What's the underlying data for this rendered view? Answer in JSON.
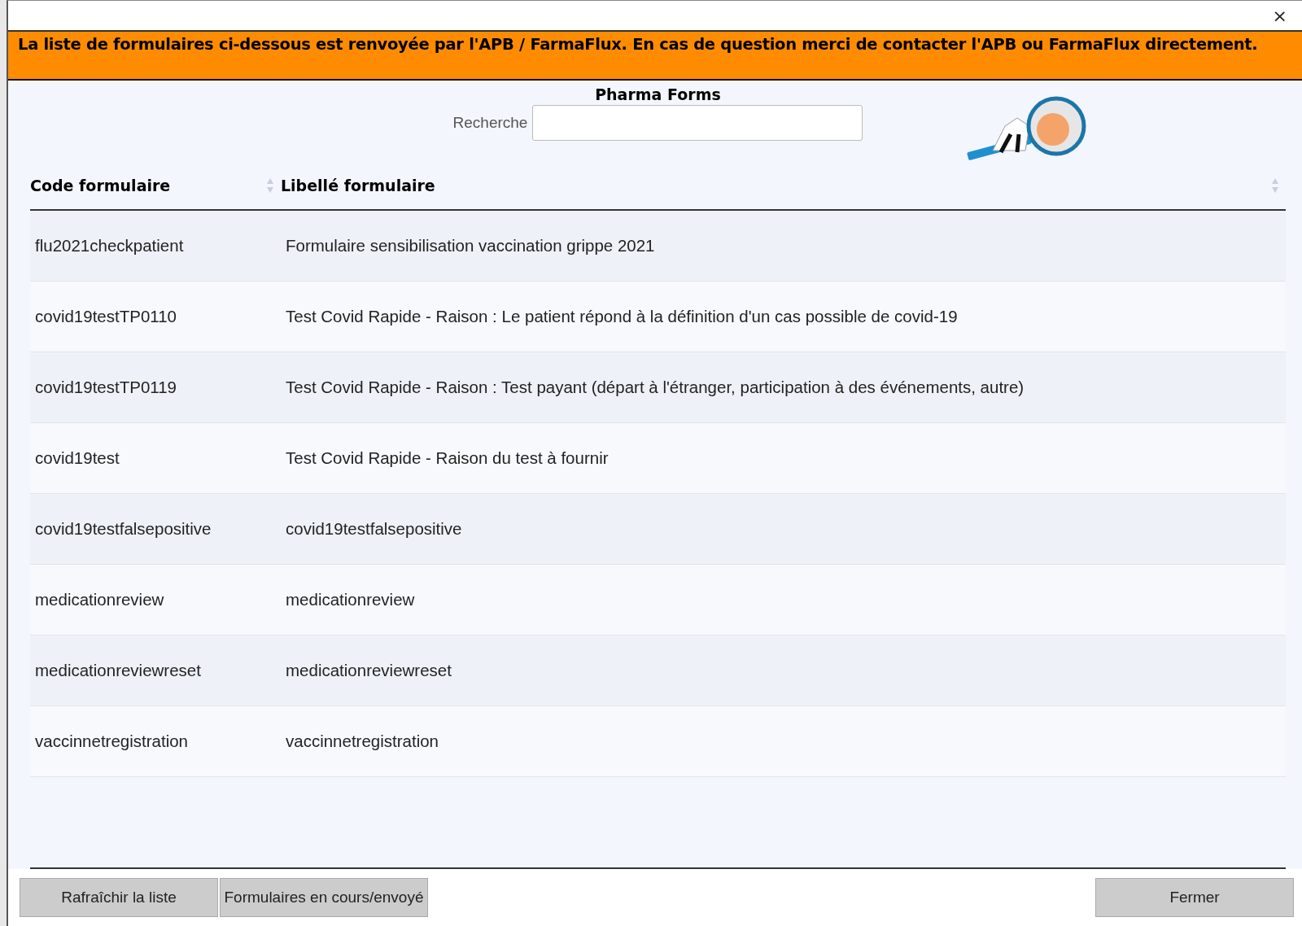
{
  "window": {
    "close": "×"
  },
  "banner": "La liste de formulaires ci-dessous est renvoyée par l'APB / FarmaFlux. En cas de question merci de contacter l'APB ou FarmaFlux directement.",
  "title": "Pharma Forms",
  "search": {
    "label": "Recherche"
  },
  "table": {
    "columns": [
      "Code formulaire",
      "Libellé formulaire"
    ],
    "rows": [
      {
        "code": "flu2021checkpatient",
        "label": "Formulaire sensibilisation vaccination grippe 2021"
      },
      {
        "code": "covid19testTP0110",
        "label": "Test Covid Rapide - Raison : Le patient répond à la définition d'un cas possible de covid-19"
      },
      {
        "code": "covid19testTP0119",
        "label": "Test Covid Rapide - Raison : Test payant (départ à l'étranger, participation à des événements, autre)"
      },
      {
        "code": "covid19test",
        "label": "Test Covid Rapide - Raison du test à fournir"
      },
      {
        "code": "covid19testfalsepositive",
        "label": "covid19testfalsepositive"
      },
      {
        "code": "medicationreview",
        "label": "medicationreview"
      },
      {
        "code": "medicationreviewreset",
        "label": "medicationreviewreset"
      },
      {
        "code": "vaccinnetregistration",
        "label": "vaccinnetregistration"
      }
    ]
  },
  "buttons_left": [
    "Rafraîchir la liste",
    "Formulaires en cours/envoyé"
  ],
  "button_right": "Fermer"
}
